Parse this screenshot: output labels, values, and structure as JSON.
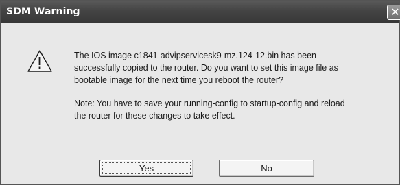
{
  "dialog": {
    "title": "SDM Warning",
    "close_glyph": "✕",
    "icon": "warning-icon",
    "message_lines": [
      "The IOS image c1841-advipservicesk9-mz.124-12.bin has been",
      "successfully copied to the router. Do you want to set this image file as",
      "bootable image for the next time you reboot the router?"
    ],
    "note_lines": [
      "Note: You have to save your running-config to startup-config and reload",
      "the router for these changes to take effect."
    ],
    "buttons": {
      "yes": "Yes",
      "no": "No"
    }
  }
}
